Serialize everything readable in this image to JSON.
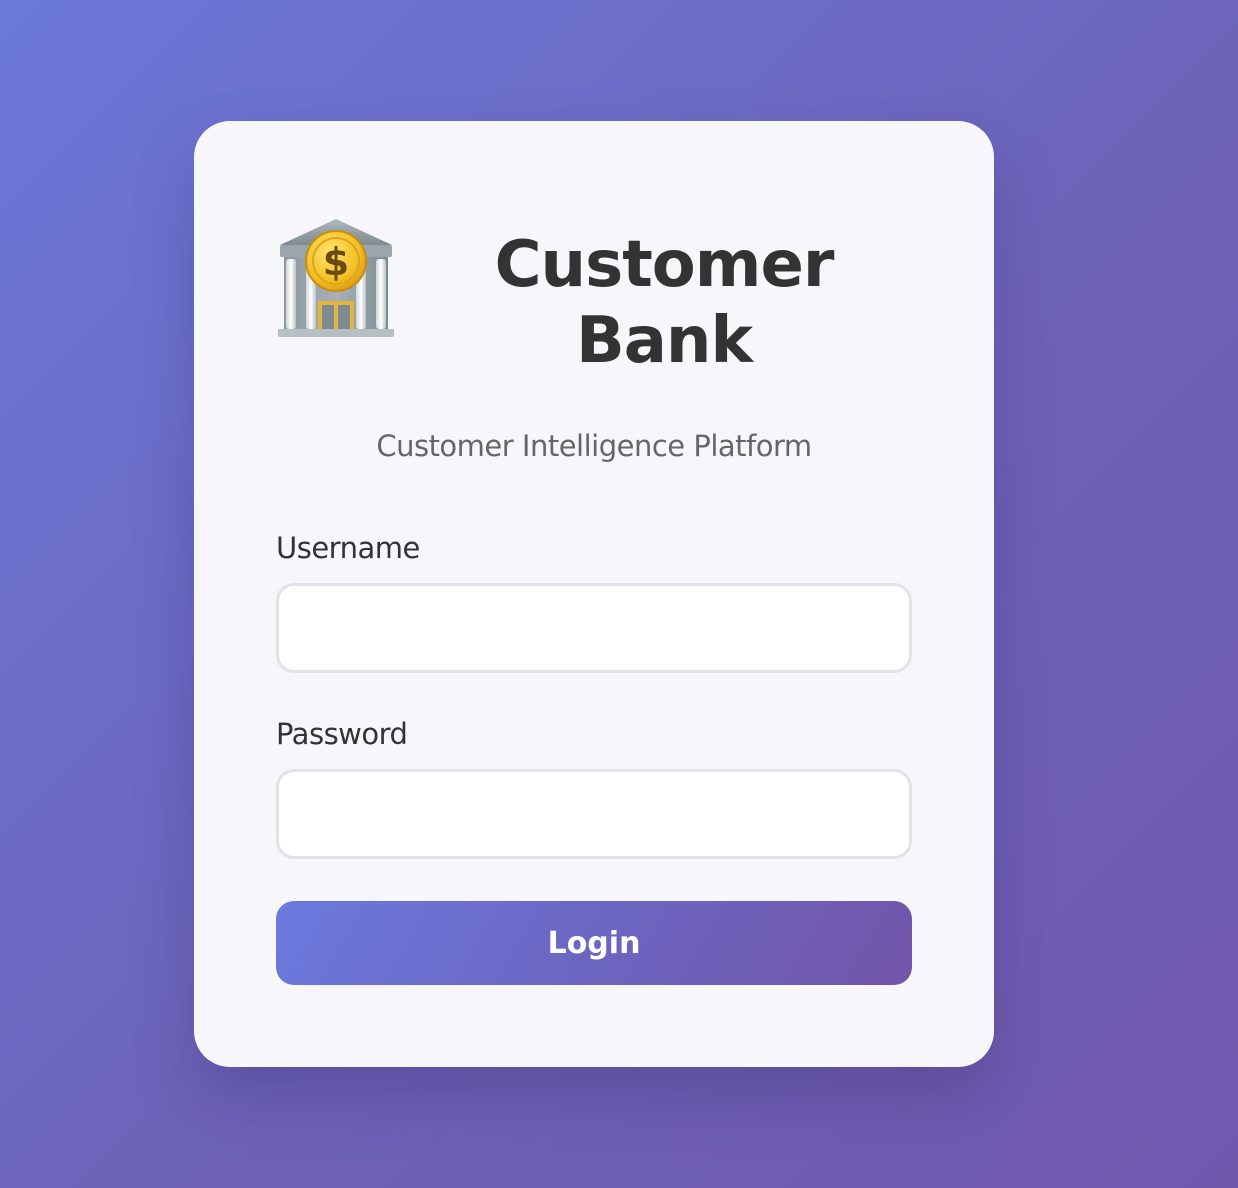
{
  "brand": {
    "title": "Customer Bank",
    "subtitle": "Customer Intelligence Platform",
    "logo_icon": "bank-building-icon"
  },
  "form": {
    "username_label": "Username",
    "username_value": "",
    "password_label": "Password",
    "password_value": "",
    "login_label": "Login"
  },
  "colors": {
    "background_start": "#6b78d8",
    "background_end": "#7058ad",
    "card": "#f7f7fb",
    "title": "#333333",
    "subtitle": "#666666",
    "button_start": "#6b7ade",
    "button_end": "#7255a8"
  }
}
